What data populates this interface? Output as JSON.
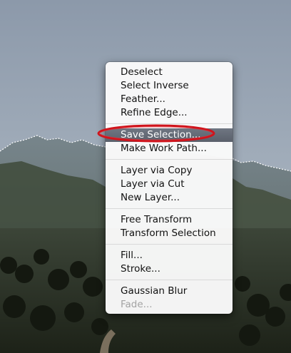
{
  "context_menu": {
    "groups": [
      {
        "items": [
          {
            "label": "Deselect"
          },
          {
            "label": "Select Inverse"
          },
          {
            "label": "Feather..."
          },
          {
            "label": "Refine Edge..."
          }
        ]
      },
      {
        "items": [
          {
            "label": "Save Selection...",
            "state": "highlighted"
          },
          {
            "label": "Make Work Path..."
          }
        ]
      },
      {
        "items": [
          {
            "label": "Layer via Copy"
          },
          {
            "label": "Layer via Cut"
          },
          {
            "label": "New Layer..."
          }
        ]
      },
      {
        "items": [
          {
            "label": "Free Transform"
          },
          {
            "label": "Transform Selection"
          }
        ]
      },
      {
        "items": [
          {
            "label": "Fill..."
          },
          {
            "label": "Stroke..."
          }
        ]
      },
      {
        "items": [
          {
            "label": "Gaussian Blur"
          },
          {
            "label": "Fade...",
            "state": "disabled"
          }
        ]
      }
    ]
  },
  "colors": {
    "highlight": "#5f6570",
    "annotation_ring": "#d0141c",
    "sky_top": "#8e9bad",
    "sky_bottom": "#b7c2cb",
    "mountains": "#5c6868"
  }
}
